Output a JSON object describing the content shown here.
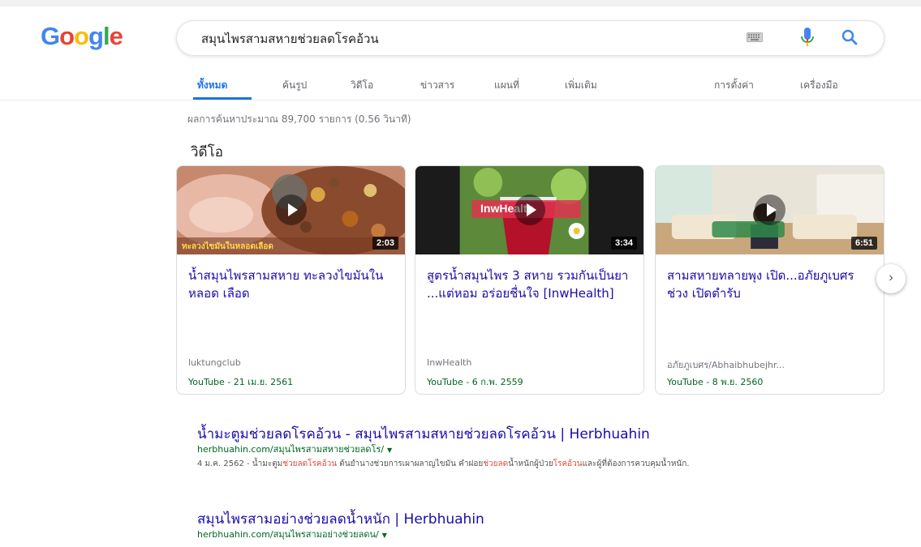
{
  "logo": {
    "letters": [
      "G",
      "o",
      "o",
      "g",
      "l",
      "e"
    ]
  },
  "search": {
    "query": "สมุนไพรสามสหายช่วยลดโรคอ้วน",
    "keyboard_icon": "keyboard-icon",
    "mic_icon": "microphone-icon",
    "search_icon": "magnifier-icon"
  },
  "tabs": [
    {
      "label": "ทั้งหมด",
      "active": true
    },
    {
      "label": "ค้นรูป",
      "active": false
    },
    {
      "label": "วิดีโอ",
      "active": false
    },
    {
      "label": "ข่าวสาร",
      "active": false
    },
    {
      "label": "แผนที่",
      "active": false
    },
    {
      "label": "เพิ่มเติม",
      "active": false
    },
    {
      "label": "การตั้งค่า",
      "active": false
    },
    {
      "label": "เครื่องมือ",
      "active": false
    }
  ],
  "result_stats": "ผลการค้นหาประมาณ 89,700 รายการ (0.56 วินาที)",
  "video_section": {
    "heading": "วิดีโอ",
    "cards": [
      {
        "title": "น้ำสมุนไพรสามสหาย ทะลวงไขมันในหลอด เลือด",
        "duration": "2:03",
        "channel": "luktungclub",
        "source": "YouTube - 21 เม.ย. 2561",
        "thumb_caption": "ทะลวงไขมันในหลอดเลือด"
      },
      {
        "title": "สูตรน้ำสมุนไพร 3 สหาย รวมกันเป็นยา ...แต่หอม อร่อยชื่นใจ [InwHealth]",
        "duration": "3:34",
        "channel": "InwHealth",
        "source": "YouTube - 6 ก.พ. 2559",
        "thumb_caption": "InwHealth"
      },
      {
        "title": "สามสหายทลายพุง เปิด...อภัยภูเบศร ช่วง เปิดตำรับ",
        "duration": "6:51",
        "channel": "อภัยภูเบศร/Abhaibhubejhr...",
        "source": "YouTube - 8 พ.ย. 2560",
        "thumb_caption": ""
      }
    ],
    "next_icon": "chevron-right-icon"
  },
  "results": [
    {
      "title": "น้ำมะตูมช่วยลดโรคอ้วน - สมุนไพรสามสหายช่วยลดโรคอ้วน | Herbhuahin",
      "url": "herbhuahin.com/สมุนไพรสามสหายช่วยลดโร/",
      "snippet_parts": [
        {
          "text": "4 ม.ค. 2562 - น้ำมะตูม",
          "hl": false
        },
        {
          "text": "ช่วยลดโรคอ้วน",
          "hl": true
        },
        {
          "text": " ต้นยำนางช่วยการเผาผลาญไขมัน คำฝอย",
          "hl": false
        },
        {
          "text": "ช่วยลด",
          "hl": true
        },
        {
          "text": "น้ำหนักผู้ป่วย",
          "hl": false
        },
        {
          "text": "โรคอ้วน",
          "hl": true
        },
        {
          "text": "และผู้ที่ต้องการควบคุมน้ำหนัก.",
          "hl": false
        }
      ]
    },
    {
      "title": "สมุนไพรสามอย่างช่วยลดน้ำหนัก | Herbhuahin",
      "url": "herbhuahin.com/สมุนไพรสามอย่างช่วยลดน/",
      "snippet_parts": []
    }
  ]
}
